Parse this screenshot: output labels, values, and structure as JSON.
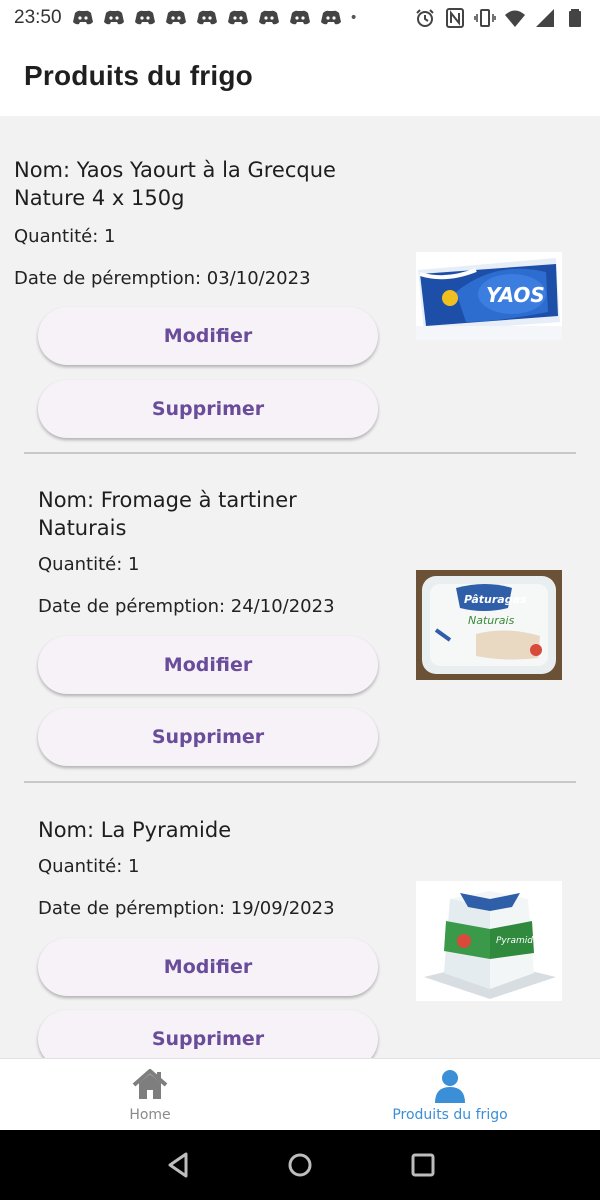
{
  "status_bar": {
    "time": "23:50",
    "notification_icons": [
      "discord-icon",
      "discord-icon",
      "discord-icon",
      "discord-icon",
      "discord-icon",
      "discord-icon",
      "discord-icon",
      "discord-icon",
      "discord-icon"
    ],
    "system_icons": [
      "alarm-icon",
      "nfc-icon",
      "vibrate-icon",
      "wifi-icon",
      "signal-icon",
      "battery-icon"
    ]
  },
  "app_bar": {
    "title": "Produits du frigo"
  },
  "products": [
    {
      "name": "Nom: Yaos Yaourt à la Grecque Nature 4 x 150g",
      "quantity": "Quantité: 1",
      "expiry": "Date de péremption: 03/10/2023",
      "modify_label": "Modifier",
      "delete_label": "Supprimer",
      "image": "yaos-yogurt-pack"
    },
    {
      "name": "Nom: Fromage à tartiner Naturais",
      "quantity": "Quantité: 1",
      "expiry": "Date de péremption: 24/10/2023",
      "modify_label": "Modifier",
      "delete_label": "Supprimer",
      "image": "paturages-naturais-tub"
    },
    {
      "name": "Nom: La Pyramide",
      "quantity": "Quantité: 1",
      "expiry": "Date de péremption: 19/09/2023",
      "modify_label": "Modifier",
      "delete_label": "Supprimer",
      "image": "la-pyramide-cheese"
    }
  ],
  "bottom_nav": {
    "items": [
      {
        "label": "Home",
        "icon": "home-icon",
        "active": false
      },
      {
        "label": "Produits du frigo",
        "icon": "person-icon",
        "active": true
      }
    ]
  },
  "colors": {
    "accent": "#6a4d9a",
    "button_bg": "#f7f1f8",
    "active_nav": "#3a8fd6",
    "inactive_nav": "#8a8a8a"
  }
}
